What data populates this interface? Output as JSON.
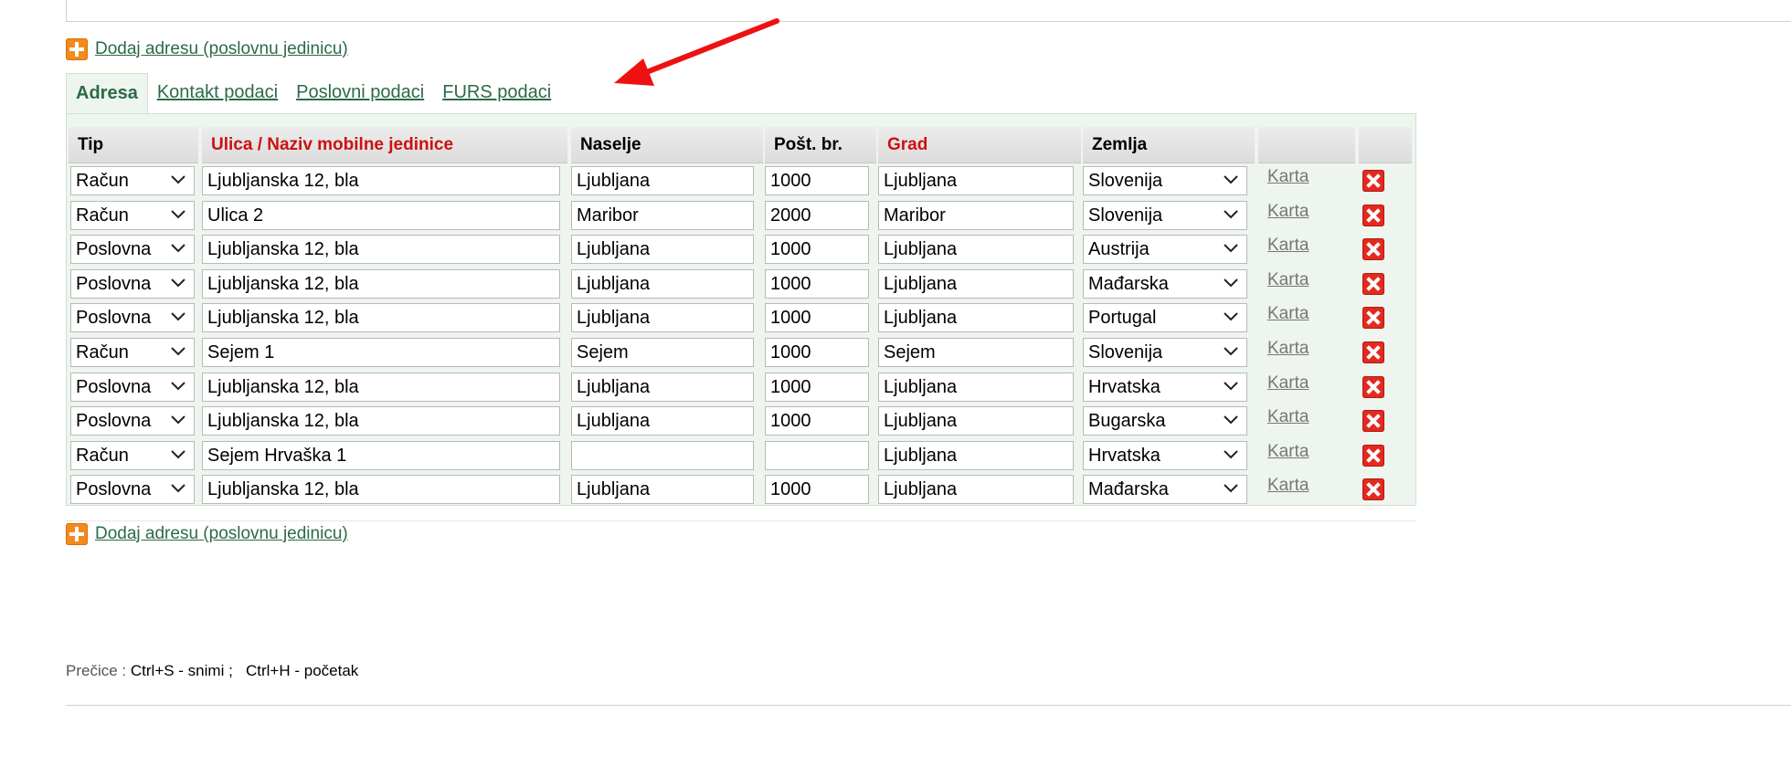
{
  "add_address_label": "Dodaj adresu (poslovnu jedinicu)",
  "tabs": [
    {
      "label": "Adresa",
      "active": true
    },
    {
      "label": "Kontakt podaci",
      "active": false
    },
    {
      "label": "Poslovni podaci",
      "active": false
    },
    {
      "label": "FURS podaci",
      "active": false
    }
  ],
  "table": {
    "headers": [
      "Tip",
      "Ulica / Naziv mobilne jedinice",
      "Naselje",
      "Pošt. br.",
      "Grad",
      "Zemlja"
    ],
    "required_headers": [
      "Ulica / Naziv mobilne jedinice",
      "Grad"
    ],
    "map_label": "Karta",
    "rows": [
      {
        "tip": "Račun",
        "ulica": "Ljubljanska 12, bla",
        "naselje": "Ljubljana",
        "post": "1000",
        "grad": "Ljubljana",
        "zemlja": "Slovenija"
      },
      {
        "tip": "Račun",
        "ulica": "Ulica 2",
        "naselje": "Maribor",
        "post": "2000",
        "grad": "Maribor",
        "zemlja": "Slovenija"
      },
      {
        "tip": "Poslovna",
        "ulica": "Ljubljanska 12, bla",
        "naselje": "Ljubljana",
        "post": "1000",
        "grad": "Ljubljana",
        "zemlja": "Austrija"
      },
      {
        "tip": "Poslovna",
        "ulica": "Ljubljanska 12, bla",
        "naselje": "Ljubljana",
        "post": "1000",
        "grad": "Ljubljana",
        "zemlja": "Mađarska"
      },
      {
        "tip": "Poslovna",
        "ulica": "Ljubljanska 12, bla",
        "naselje": "Ljubljana",
        "post": "1000",
        "grad": "Ljubljana",
        "zemlja": "Portugal"
      },
      {
        "tip": "Račun",
        "ulica": "Sejem 1",
        "naselje": "Sejem",
        "post": "1000",
        "grad": "Sejem",
        "zemlja": "Slovenija"
      },
      {
        "tip": "Poslovna",
        "ulica": "Ljubljanska 12, bla",
        "naselje": "Ljubljana",
        "post": "1000",
        "grad": "Ljubljana",
        "zemlja": "Hrvatska"
      },
      {
        "tip": "Poslovna",
        "ulica": "Ljubljanska 12, bla",
        "naselje": "Ljubljana",
        "post": "1000",
        "grad": "Ljubljana",
        "zemlja": "Bugarska"
      },
      {
        "tip": "Račun",
        "ulica": "Sejem Hrvaška 1",
        "naselje": "",
        "post": "",
        "grad": "Ljubljana",
        "zemlja": "Hrvatska"
      },
      {
        "tip": "Poslovna",
        "ulica": "Ljubljanska 12, bla",
        "naselje": "Ljubljana",
        "post": "1000",
        "grad": "Ljubljana",
        "zemlja": "Mađarska"
      }
    ]
  },
  "shortcuts": {
    "prefix": "Prečice :",
    "save": "Ctrl+S - snimi ;",
    "home": "Ctrl+H - početak"
  },
  "colors": {
    "link": "#2b6a48",
    "required": "#cc1111",
    "panel_bg": "#eef5ee",
    "annotation_arrow": "#ee1111"
  },
  "icons": {
    "add": "plus-icon",
    "delete": "delete-icon",
    "select": "chevron-down-icon"
  }
}
